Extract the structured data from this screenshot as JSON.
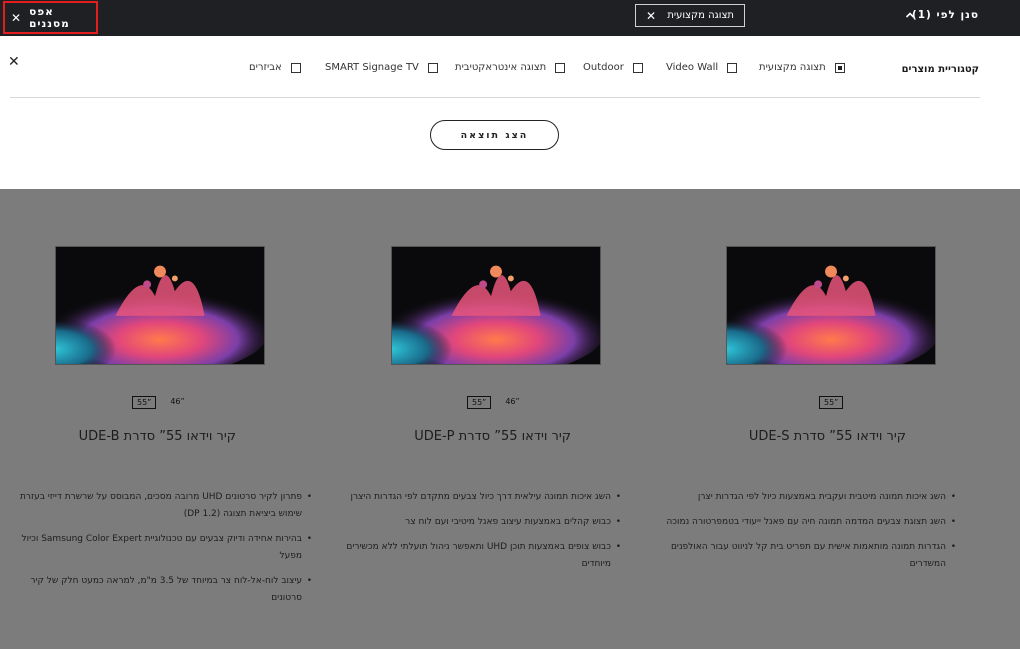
{
  "topbar": {
    "reset_label": "אפס מסננים",
    "chip_label": "תצוגה מקצועית",
    "filter_by_label": "סנן לפי (1)"
  },
  "panel": {
    "category_title": "קטגוריית מוצרים",
    "options": [
      {
        "label": "תצוגה מקצועית",
        "checked": true
      },
      {
        "label": "Video Wall",
        "checked": false
      },
      {
        "label": "Outdoor",
        "checked": false
      },
      {
        "label": "תצוגה אינטראקטיבית",
        "checked": false
      },
      {
        "label": "SMART Signage TV",
        "checked": false
      },
      {
        "label": "אביזרים",
        "checked": false
      }
    ],
    "apply_label": "הצג תוצאה"
  },
  "products": [
    {
      "title": "קיר וידאו 55” סדרת UDE-S",
      "sizes": [
        {
          "label": "55”",
          "selected": true
        }
      ],
      "bullets": [
        "השג איכות תמונה מיטבית ועקבית באמצעות כיול לפי הגדרות יצרן",
        "השג תצוגת צבעים המדמה תמונה חיה עם פאנל ייעודי בטמפרטורה נמוכה",
        "הגדרות תמונה מותאמות אישית עם תפריט בית קל לניווט עבור האולפנים המשדרים"
      ]
    },
    {
      "title": "קיר וידאו 55” סדרת UDE-P",
      "sizes": [
        {
          "label": "55”",
          "selected": true
        },
        {
          "label": "46”",
          "selected": false
        }
      ],
      "bullets": [
        "השג איכות תמונה עילאית דרך כיול צבעים מתקדם לפי הגדרות היצרן",
        "כבוש קהלים באמצעות עיצוב פאנל מיטיבי ועם לוח צר",
        "כבוש צופים באמצעות תוכן UHD ותאפשר ניהול תועלתי ללא מכשירים מיוחדים"
      ]
    },
    {
      "title": "קיר וידאו 55” סדרת UDE-B",
      "sizes": [
        {
          "label": "55”",
          "selected": true
        },
        {
          "label": "46”",
          "selected": false
        }
      ],
      "bullets": [
        "פתרון לקיר סרטונים UHD מרובה מסכים, המבוסס על שרשרת דייזי בעזרת שימוש ביציאת תצוגה (DP 1.2)",
        "בהירות אחידה ודיוק צבעים עם טכנולוגיית Samsung Color Expert וכיול מפעל",
        "עיצוב לוח-אל-לוח צר במיוחד של 3.5 מ\"מ, למראה כמעט חלק של קיר סרטונים"
      ]
    }
  ]
}
